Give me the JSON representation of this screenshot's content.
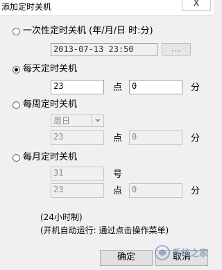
{
  "window": {
    "title": "添加定时关机",
    "close_label": "X"
  },
  "once": {
    "label": "一次性定时关机  (年/月/日 时:分)",
    "checked": false,
    "datetime_value": "2013-07-13 23:50",
    "browse_label": "..."
  },
  "daily": {
    "label": "每天定时关机",
    "checked": true,
    "hour_value": "23",
    "hour_unit": "点",
    "minute_value": "0",
    "minute_unit": "分"
  },
  "weekly": {
    "label": "每周定时关机",
    "checked": false,
    "weekday_value": "周日",
    "hour_value": "23",
    "hour_unit": "点",
    "minute_value": "0",
    "minute_unit": "分"
  },
  "monthly": {
    "label": "每月定时关机",
    "checked": false,
    "day_value": "31",
    "day_unit": "号",
    "hour_value": "23",
    "hour_unit": "点",
    "minute_value": "0",
    "minute_unit": "分"
  },
  "notes": {
    "format": "(24小时制)",
    "autorun": "(开机自动运行: 通过点击操作菜单)"
  },
  "buttons": {
    "ok_label": "确定",
    "cancel_label": "取消"
  },
  "watermark": {
    "text": "系统之家"
  }
}
